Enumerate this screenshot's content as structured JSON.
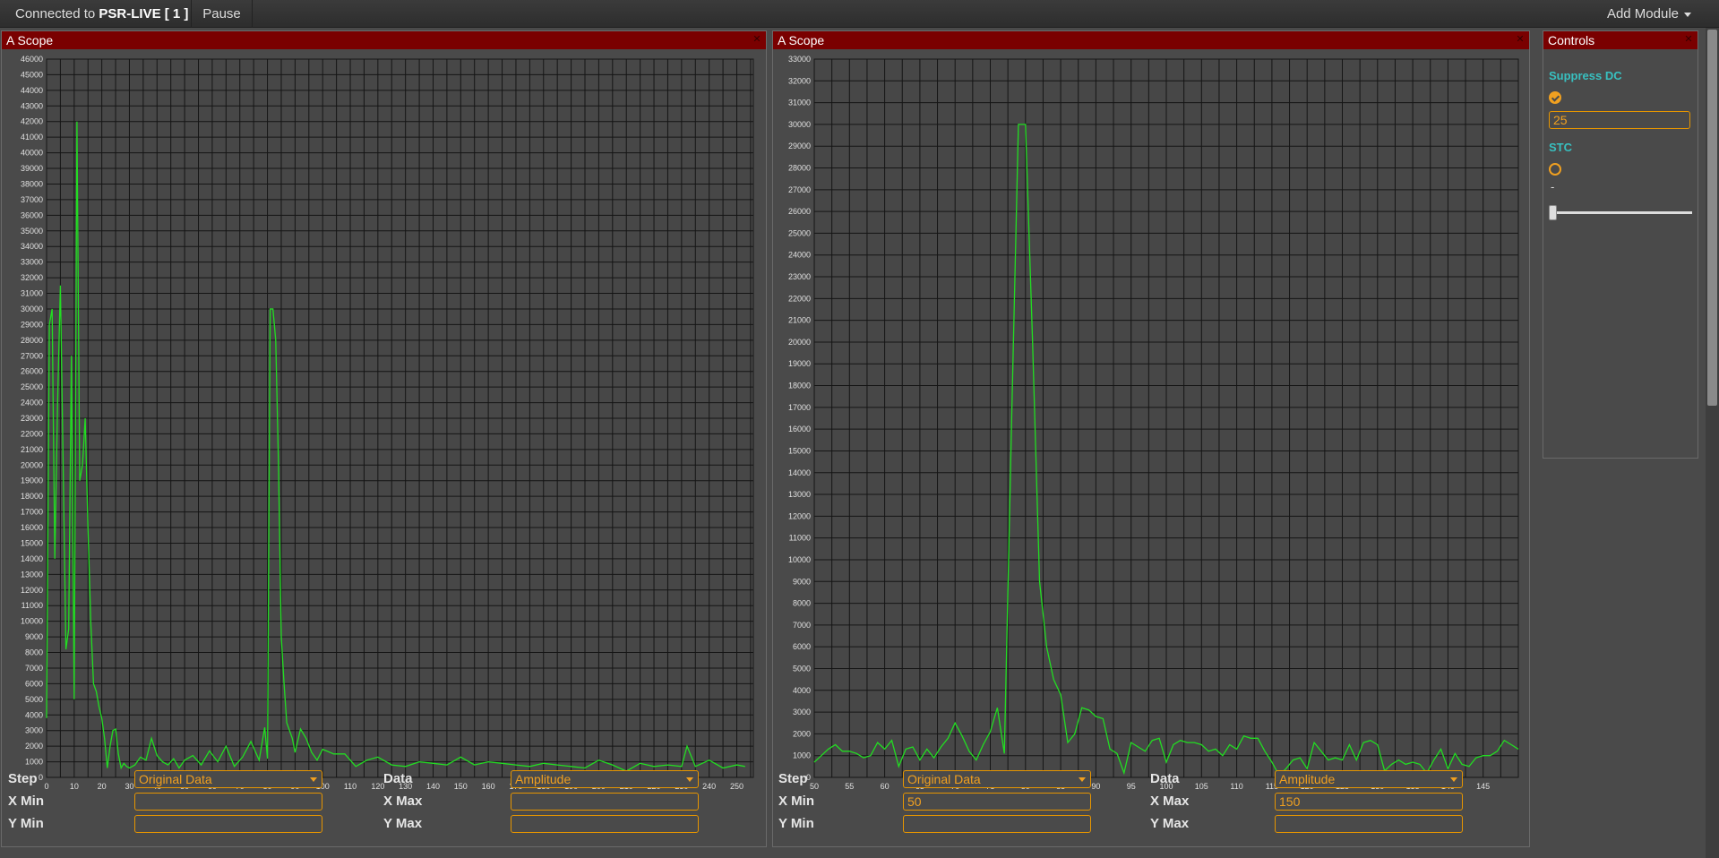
{
  "topbar": {
    "connection_prefix": "Connected to",
    "connection_name": "PSR-LIVE [ 1 ]",
    "pause_label": "Pause",
    "add_module_label": "Add Module"
  },
  "colors": {
    "panel_header": "#7a0000",
    "plot_line": "#22dd22",
    "accent": "#f0a020",
    "label_teal": "#38c0c0"
  },
  "scopes": [
    {
      "title": "A Scope",
      "form": {
        "step_label": "Step",
        "step_value": "Original Data",
        "data_label": "Data",
        "data_value": "Amplitude",
        "xmin_label": "X Min",
        "xmin_value": "",
        "xmax_label": "X Max",
        "xmax_value": "",
        "ymin_label": "Y Min",
        "ymin_value": "",
        "ymax_label": "Y Max",
        "ymax_value": ""
      }
    },
    {
      "title": "A Scope",
      "form": {
        "step_label": "Step",
        "step_value": "Original Data",
        "data_label": "Data",
        "data_value": "Amplitude",
        "xmin_label": "X Min",
        "xmin_value": "50",
        "xmax_label": "X Max",
        "xmax_value": "150",
        "ymin_label": "Y Min",
        "ymin_value": "",
        "ymax_label": "Y Max",
        "ymax_value": ""
      }
    }
  ],
  "controls": {
    "title": "Controls",
    "suppress_dc_label": "Suppress DC",
    "suppress_dc_checked": true,
    "suppress_dc_value": "25",
    "stc_label": "STC",
    "stc_checked": false,
    "stc_dash": "-",
    "stc_slider_fraction": 0
  },
  "chart_data": [
    {
      "type": "line",
      "title": "A Scope",
      "xlim": [
        0,
        256
      ],
      "ylim": [
        0,
        46000
      ],
      "xticks": [
        0,
        10,
        20,
        30,
        40,
        50,
        60,
        70,
        80,
        90,
        100,
        110,
        120,
        130,
        140,
        150,
        160,
        170,
        180,
        190,
        200,
        210,
        220,
        230,
        240,
        250
      ],
      "ytick_step": 1000,
      "grid": true,
      "series": [
        {
          "x": [
            0,
            1,
            2,
            3,
            4,
            5,
            6,
            7,
            8,
            9,
            10,
            11,
            12,
            13,
            14,
            15,
            16,
            17,
            18,
            19,
            20,
            21,
            22,
            23,
            24,
            25,
            26,
            27,
            28,
            29,
            30,
            32,
            34,
            36,
            38,
            40,
            42,
            44,
            46,
            48,
            50,
            53,
            56,
            59,
            62,
            65,
            68,
            71,
            74,
            77,
            79,
            80,
            81,
            82,
            83,
            84,
            85,
            86,
            87,
            88,
            89,
            90,
            92,
            94,
            96,
            98,
            100,
            104,
            108,
            112,
            116,
            120,
            125,
            130,
            135,
            140,
            145,
            150,
            155,
            160,
            165,
            170,
            175,
            180,
            185,
            190,
            195,
            200,
            205,
            210,
            215,
            220,
            225,
            230,
            232,
            235,
            240,
            245,
            250,
            253
          ],
          "y": [
            3800,
            29000,
            30000,
            14000,
            24000,
            31500,
            20000,
            8200,
            9500,
            27000,
            5000,
            42000,
            19000,
            20000,
            23000,
            16000,
            10000,
            6000,
            5500,
            4500,
            3800,
            2500,
            600,
            2000,
            3000,
            3100,
            1500,
            600,
            900,
            700,
            600,
            800,
            1300,
            1100,
            2500,
            1400,
            1000,
            800,
            1200,
            600,
            1100,
            1400,
            800,
            1700,
            1000,
            2000,
            700,
            1300,
            2300,
            1100,
            3200,
            1200,
            30000,
            30000,
            28000,
            20000,
            9000,
            6000,
            3500,
            3000,
            2500,
            1600,
            3100,
            2500,
            1600,
            1100,
            1800,
            1500,
            1500,
            700,
            1100,
            1300,
            800,
            700,
            1000,
            900,
            800,
            1300,
            800,
            1000,
            900,
            800,
            700,
            900,
            800,
            700,
            600,
            1100,
            800,
            400,
            900,
            700,
            800,
            700,
            2000,
            700,
            1100,
            600,
            800,
            700
          ]
        }
      ]
    },
    {
      "type": "line",
      "title": "A Scope",
      "xlim": [
        50,
        150
      ],
      "ylim": [
        0,
        33000
      ],
      "xticks": [
        50,
        55,
        60,
        65,
        70,
        75,
        80,
        85,
        90,
        95,
        100,
        105,
        110,
        115,
        120,
        125,
        130,
        135,
        140,
        145
      ],
      "ytick_step": 1000,
      "grid": true,
      "series": [
        {
          "x": [
            50,
            51,
            52,
            53,
            54,
            55,
            56,
            57,
            58,
            59,
            60,
            61,
            62,
            63,
            64,
            65,
            66,
            67,
            68,
            69,
            70,
            71,
            72,
            73,
            74,
            75,
            76,
            77,
            78,
            79,
            80,
            81,
            82,
            83,
            84,
            85,
            86,
            87,
            88,
            89,
            90,
            91,
            92,
            93,
            94,
            95,
            96,
            97,
            98,
            99,
            100,
            101,
            102,
            103,
            104,
            105,
            106,
            107,
            108,
            109,
            110,
            111,
            112,
            113,
            114,
            115,
            116,
            117,
            118,
            119,
            120,
            121,
            122,
            123,
            124,
            125,
            126,
            127,
            128,
            129,
            130,
            131,
            132,
            133,
            134,
            135,
            136,
            137,
            138,
            139,
            140,
            141,
            142,
            143,
            144,
            145,
            146,
            147,
            148,
            149,
            150
          ],
          "y": [
            700,
            1000,
            1300,
            1500,
            1200,
            1200,
            1100,
            900,
            1000,
            1600,
            1300,
            1700,
            500,
            1300,
            1400,
            800,
            1300,
            900,
            1400,
            1800,
            2500,
            1900,
            1200,
            800,
            1500,
            2100,
            3200,
            1100,
            16000,
            30000,
            30000,
            20000,
            9000,
            6000,
            4500,
            3800,
            1600,
            2000,
            3200,
            3100,
            2800,
            2700,
            1300,
            1100,
            200,
            1600,
            1400,
            1200,
            1700,
            1800,
            700,
            1500,
            1700,
            1600,
            1600,
            1500,
            1200,
            1300,
            1000,
            1500,
            1300,
            1900,
            1800,
            1800,
            1200,
            700,
            100,
            400,
            800,
            900,
            400,
            1600,
            1200,
            800,
            900,
            800,
            1500,
            800,
            1600,
            1700,
            1500,
            300,
            600,
            800,
            600,
            700,
            600,
            200,
            800,
            1300,
            400,
            1100,
            600,
            500,
            900,
            1000,
            1000,
            1200,
            1700,
            1500,
            1300
          ]
        }
      ]
    }
  ]
}
